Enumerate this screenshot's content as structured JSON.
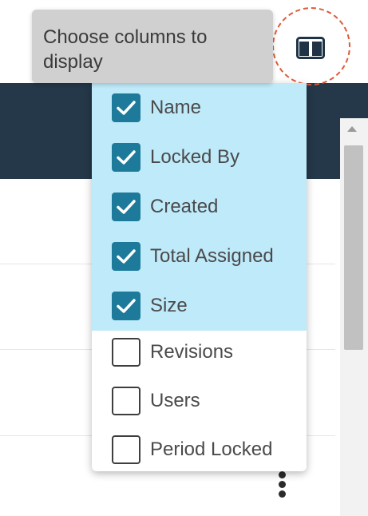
{
  "tooltip": {
    "line1": "Choose columns to",
    "line2": "display"
  },
  "column_toggle": {
    "icon": "columns-icon"
  },
  "column_menu": {
    "items": [
      {
        "label": "Name",
        "checked": true
      },
      {
        "label": "Locked By",
        "checked": true
      },
      {
        "label": "Created",
        "checked": true
      },
      {
        "label": "Total Assigned",
        "checked": true
      },
      {
        "label": "Size",
        "checked": true
      },
      {
        "label": "Revisions",
        "checked": false
      },
      {
        "label": "Users",
        "checked": false
      },
      {
        "label": "Period Locked",
        "checked": false
      }
    ]
  },
  "colors": {
    "header_bg": "#24384a",
    "checked_bg": "#bfeafa",
    "checkbox_fill": "#1d7a9b",
    "focus_ring": "#dd5a3a"
  }
}
